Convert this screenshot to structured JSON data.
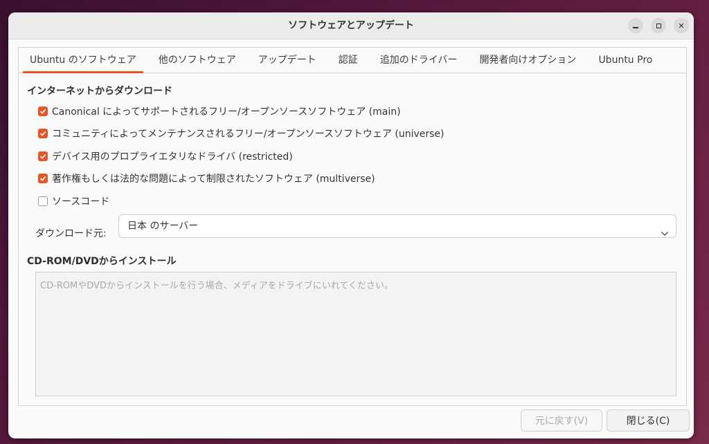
{
  "window": {
    "title": "ソフトウェアとアップデート"
  },
  "tabs": [
    {
      "label": "Ubuntu のソフトウェア",
      "active": true
    },
    {
      "label": "他のソフトウェア",
      "active": false
    },
    {
      "label": "アップデート",
      "active": false
    },
    {
      "label": "認証",
      "active": false
    },
    {
      "label": "追加のドライバー",
      "active": false
    },
    {
      "label": "開発者向けオプション",
      "active": false
    },
    {
      "label": "Ubuntu Pro",
      "active": false
    }
  ],
  "download": {
    "heading": "インターネットからダウンロード",
    "options": [
      {
        "label": "Canonical によってサポートされるフリー/オープンソースソフトウェア (main)",
        "checked": true
      },
      {
        "label": "コミュニティによってメンテナンスされるフリー/オープンソースソフトウェア (universe)",
        "checked": true
      },
      {
        "label": "デバイス用のプロプライエタリなドライバ (restricted)",
        "checked": true
      },
      {
        "label": "著作権もしくは法的な問題によって制限されたソフトウェア (multiverse)",
        "checked": true
      },
      {
        "label": "ソースコード",
        "checked": false
      }
    ],
    "source_label": "ダウンロード元:",
    "source_value": "日本 のサーバー"
  },
  "cdrom": {
    "heading": "CD-ROM/DVDからインストール",
    "placeholder": "CD-ROMやDVDからインストールを行う場合、メディアをドライブにいれてください。"
  },
  "buttons": {
    "revert": "元に戻す(V)",
    "close": "閉じる(C)"
  },
  "colors": {
    "accent": "#e95420"
  }
}
